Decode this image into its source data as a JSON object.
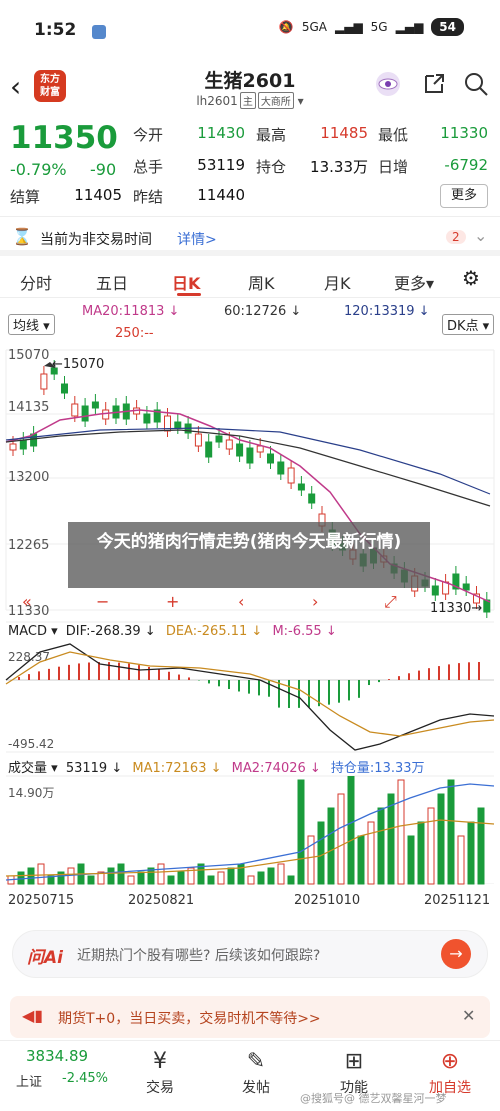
{
  "status": {
    "time": "1:52",
    "net1": "5GA",
    "net2": "5G",
    "battery": "54"
  },
  "header": {
    "logo": "东方\n财富",
    "title": "生猪2601",
    "code": "lh2601",
    "tag1": "主",
    "tag2": "大商所"
  },
  "quote": {
    "price": "11350",
    "change_pct": "-0.79%",
    "change": "-90",
    "labels": {
      "open": "今开",
      "high": "最高",
      "low": "最低",
      "vol": "总手",
      "oi": "持仓",
      "oi_chg": "日增",
      "settle": "结算",
      "prev": "昨结"
    },
    "values": {
      "open": "11430",
      "high": "11485",
      "low": "11330",
      "vol": "53119",
      "oi": "13.33万",
      "oi_chg": "-6792",
      "settle": "11405",
      "prev": "11440"
    },
    "more": "更多"
  },
  "notice": {
    "text": "当前为非交易时间",
    "link": "详情>",
    "count": "2"
  },
  "tabs": [
    "分时",
    "五日",
    "日K",
    "周K",
    "月K",
    "更多"
  ],
  "kbar": {
    "ma_type": "均线",
    "ma20": "MA20:11813 ↓",
    "ma60": "60:12726 ↓",
    "ma120": "120:13319 ↓",
    "ma250": "250:--",
    "dk": "DK点"
  },
  "chart_axis": {
    "y1": "15070",
    "y2": "14135",
    "y3": "13200",
    "y4": "12265",
    "y5": "11330",
    "hi_label": "15070",
    "lo_label": "11330"
  },
  "overlay": "今天的猪肉行情走势(猪肉今天最新行情)",
  "macd": {
    "name": "MACD",
    "dif": "DIF:-268.39 ↓",
    "dea": "DEA:-265.11 ↓",
    "m": "M:-6.55 ↓",
    "top": "228.37",
    "bottom": "-495.42"
  },
  "volume": {
    "name": "成交量",
    "v": "53119 ↓",
    "ma1": "MA1:72163 ↓",
    "ma2": "MA2:74026 ↓",
    "oi": "持仓量:13.33万",
    "max": "14.90万"
  },
  "dates": [
    "20250715",
    "20250821",
    "20251010",
    "20251121"
  ],
  "ai": {
    "logo": "问Ai",
    "text": "近期热门个股有哪些? 后续该如何跟踪?"
  },
  "promo": {
    "text": "期货T+0，当日买卖，交易时机不等待>>"
  },
  "bottom": {
    "index_value": "3834.89",
    "index_name": "上证",
    "index_chg": "-2.45%",
    "items": [
      "交易",
      "发帖",
      "功能",
      "加自选"
    ]
  },
  "watermark": "@搜狐号@ 德艺双馨星河一梦",
  "colors": {
    "up": "#d63a2c",
    "down": "#1a9b3b",
    "accent": "#d63a2c"
  }
}
